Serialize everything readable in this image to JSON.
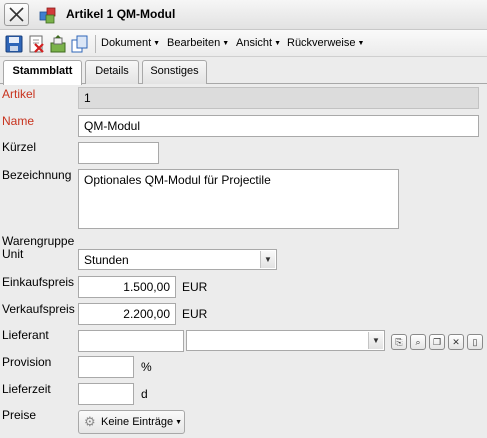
{
  "window": {
    "title": "Artikel 1 QM-Modul"
  },
  "toolbar": {
    "icons": [
      "save-icon",
      "delete-icon",
      "copy-icon",
      "duplicate-icon"
    ],
    "menus": [
      {
        "label": "Dokument"
      },
      {
        "label": "Bearbeiten"
      },
      {
        "label": "Ansicht"
      },
      {
        "label": "Rückverweise"
      }
    ]
  },
  "tabs": [
    {
      "label": "Stammblatt",
      "active": true
    },
    {
      "label": "Details",
      "active": false
    },
    {
      "label": "Sonstiges",
      "active": false
    }
  ],
  "form": {
    "artikel": {
      "label": "Artikel",
      "value": "1"
    },
    "name": {
      "label": "Name",
      "value": "QM-Modul"
    },
    "kuerzel": {
      "label": "Kürzel",
      "value": ""
    },
    "bezeichnung": {
      "label": "Bezeichnung",
      "value": "Optionales QM-Modul für Projectile"
    },
    "warengruppe": {
      "label": "Warengruppe"
    },
    "unit": {
      "label": "Unit",
      "value": "Stunden"
    },
    "einkaufspreis": {
      "label": "Einkaufspreis",
      "value": "1.500,00",
      "unit": "EUR"
    },
    "verkaufspreis": {
      "label": "Verkaufspreis",
      "value": "2.200,00",
      "unit": "EUR"
    },
    "lieferant": {
      "label": "Lieferant",
      "value": "",
      "select_value": ""
    },
    "provision": {
      "label": "Provision",
      "value": "",
      "unit": "%"
    },
    "lieferzeit": {
      "label": "Lieferzeit",
      "value": "",
      "unit": "d"
    },
    "preise": {
      "label": "Preise",
      "button_label": "Keine Einträge"
    }
  },
  "colors": {
    "required_label": "#c8331e",
    "readonly_bg": "#dcdcdc",
    "window_bg": "#ececec"
  }
}
